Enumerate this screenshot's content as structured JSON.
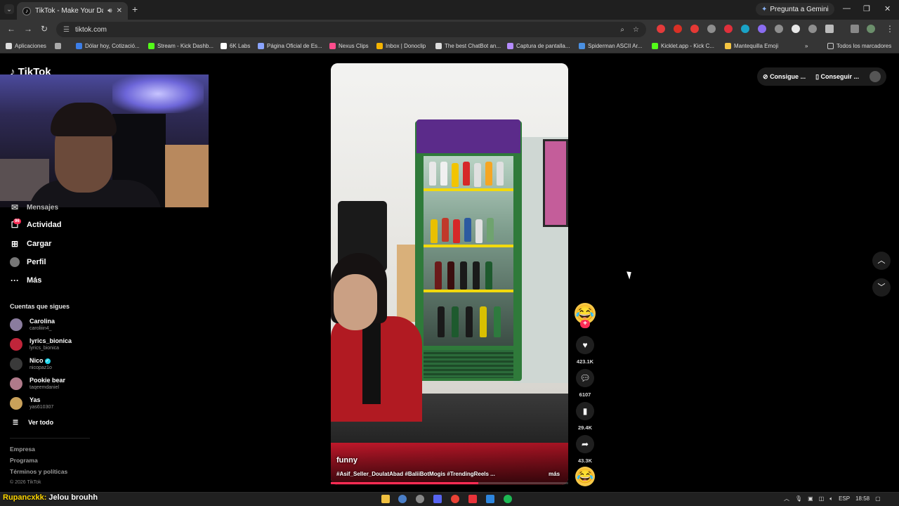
{
  "browser": {
    "tab_title": "TikTok - Make Your Day",
    "address": "tiktok.com",
    "gemini_label": "Pregunta a Gemini",
    "bookmarks": [
      {
        "label": "Aplicaciones",
        "color": "#e6e6e6"
      },
      {
        "label": "Dólar hoy, Cotizació...",
        "color": "#3c7ee8"
      },
      {
        "label": "Stream - Kick Dashb...",
        "color": "#53fc18"
      },
      {
        "label": "6K Labs",
        "color": "#ffffff"
      },
      {
        "label": "Página Oficial de Es...",
        "color": "#8aa4ff"
      },
      {
        "label": "Nexus Clips",
        "color": "#ff4d8d"
      },
      {
        "label": "Inbox | Donoclip",
        "color": "#f5b400"
      },
      {
        "label": "The best ChatBot an...",
        "color": "#dddddd"
      },
      {
        "label": "Captura de pantalla...",
        "color": "#b58cff"
      },
      {
        "label": "Spiderman ASCII Ar...",
        "color": "#4a90e2"
      },
      {
        "label": "Kicklet.app - Kick C...",
        "color": "#53fc18"
      },
      {
        "label": "Mantequilla Emoji",
        "color": "#f5c542"
      }
    ],
    "all_bookmarks": "Todos los marcadores"
  },
  "tiktok": {
    "logo": "TikTok",
    "sidebar": {
      "partial_item": "Mensajes",
      "items": [
        {
          "label": "Actividad",
          "icon": "activity-icon"
        },
        {
          "label": "Cargar",
          "icon": "upload-icon"
        },
        {
          "label": "Perfil",
          "icon": "profile-icon"
        },
        {
          "label": "Más",
          "icon": "more-icon"
        }
      ],
      "activity_badge": "96",
      "following_title": "Cuentas que sigues",
      "accounts": [
        {
          "name": "Carolina",
          "handle": "caroliiin4_",
          "color": "#8a7c9e"
        },
        {
          "name": "lyrics_bionica",
          "handle": "lyrics_bionica",
          "color": "#c0253a"
        },
        {
          "name": "Nico",
          "handle": "nicopaz1o",
          "color": "#3a3a3a"
        },
        {
          "name": "Pookie bear",
          "handle": "taqeemdaniel",
          "color": "#b07a8a"
        },
        {
          "name": "Yas",
          "handle": "yas610307",
          "color": "#c9a15a"
        }
      ],
      "see_all": "Ver todo",
      "footer": [
        "Empresa",
        "Programa",
        "Términos y políticas"
      ],
      "copyright": "© 2026 TikTok"
    },
    "video": {
      "author": "funny",
      "tags": "#Asif_Seller_DoulatAbad #BaliiBotMogis #TrendingReels ...",
      "more": "más",
      "progress": 0.62,
      "likes": "423.1K",
      "comments": "6107",
      "saves": "29.4K",
      "shares": "43.3K"
    },
    "top_right": {
      "coins": "Consigue ...",
      "app": "Conseguir ..."
    }
  },
  "taskbar": {
    "chat_user": "Rupancxkk:",
    "chat_msg": " Jelou brouhh",
    "lang": "ESP",
    "time": "18:58"
  }
}
